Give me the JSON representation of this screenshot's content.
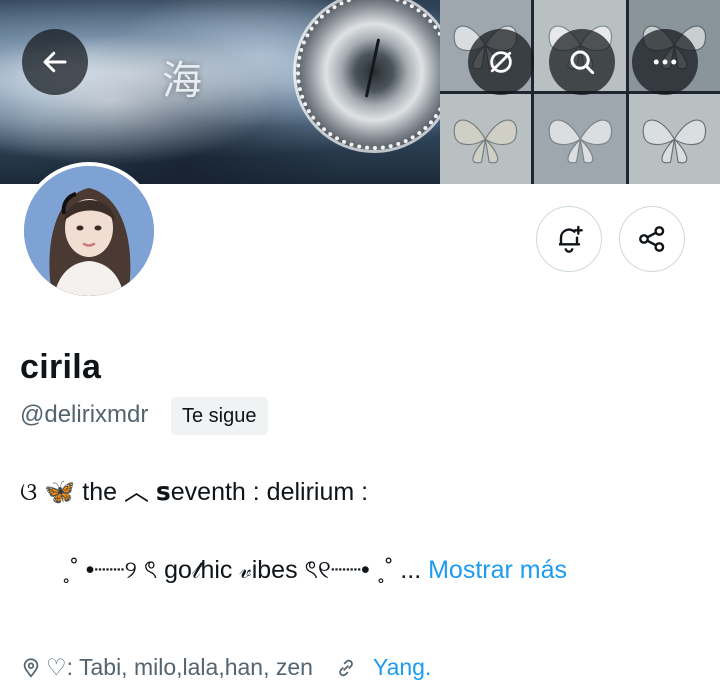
{
  "banner": {
    "kanji": "海"
  },
  "header_buttons": {
    "back": "arrow-left-icon",
    "grok": "grok-slash-circle-icon",
    "search": "search-icon",
    "more": "more-horizontal-icon"
  },
  "profile": {
    "display_name": "cirila",
    "handle": "@delirixmdr",
    "follows_you_badge": "Te sigue",
    "bio_line1": "ଓ 🦋  the  ︿ 𝘀eventh  : delirium :",
    "bio_line2": "˳˚ •┈┈୨ ৎ  go𝓉hic 𝓋ibes  ৎ୧┈┈• ˳˚ ...",
    "show_more": "Mostrar más"
  },
  "meta": {
    "location_text": "♡: Tabi, milo,lala,han, zen",
    "link_text": "Yang."
  },
  "actions": {
    "notify": "bell-plus-icon",
    "share": "share-icon"
  },
  "colors": {
    "accent": "#1d9bf0",
    "secondary_text": "#536471",
    "badge_bg": "#eff3f4"
  }
}
